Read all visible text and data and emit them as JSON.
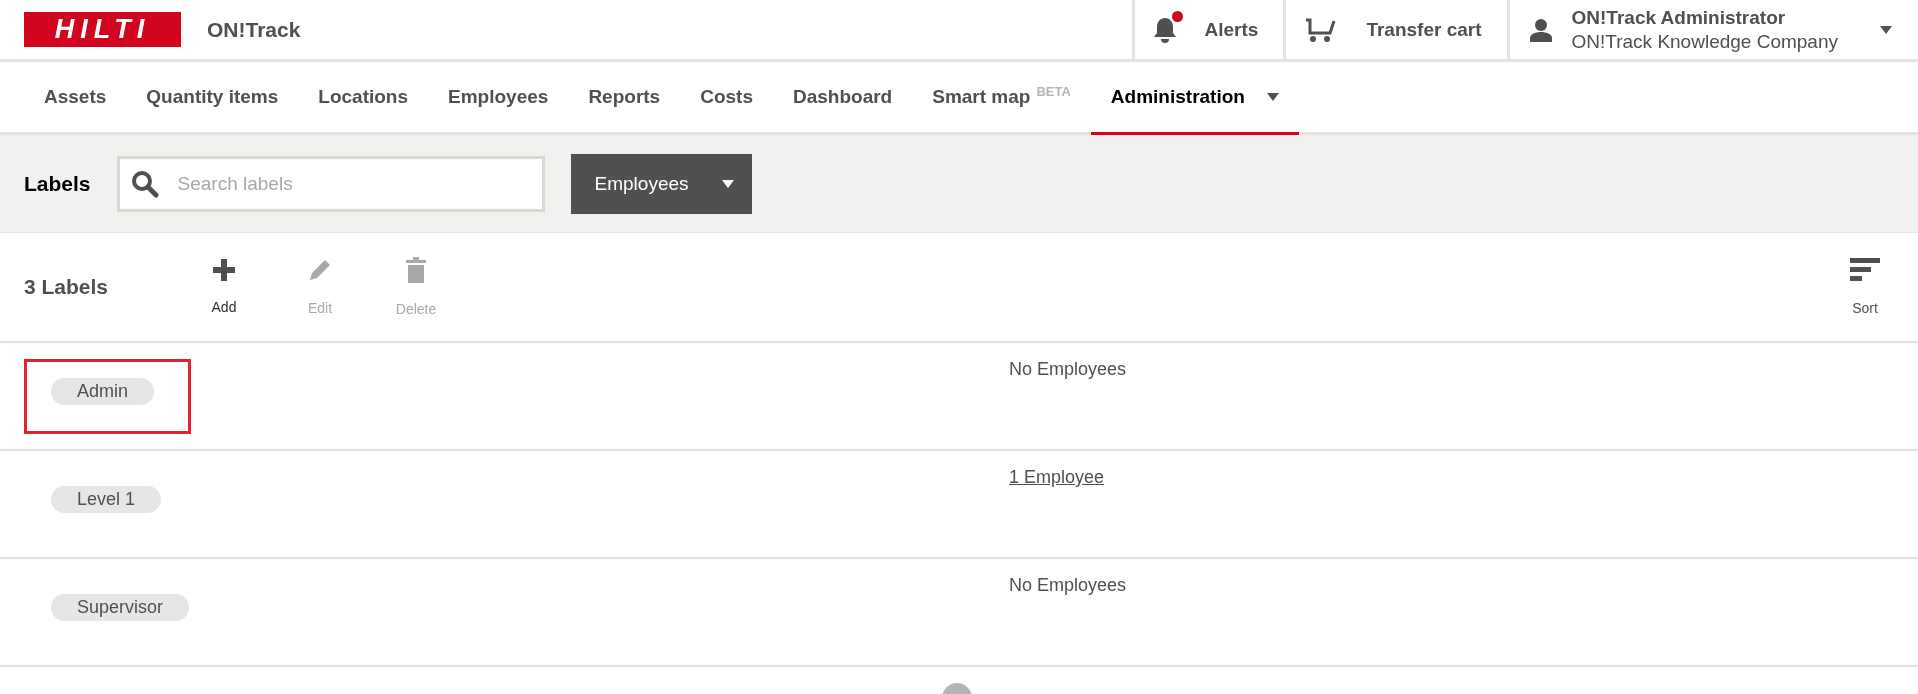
{
  "header": {
    "logo": "HILTI",
    "app_name": "ON!Track",
    "alerts": {
      "label": "Alerts",
      "unread": true
    },
    "transfer_cart": {
      "label": "Transfer cart"
    },
    "user": {
      "name": "ON!Track Administrator",
      "company": "ON!Track Knowledge Company"
    }
  },
  "nav": [
    {
      "label": "Assets",
      "selected": false
    },
    {
      "label": "Quantity items",
      "selected": false
    },
    {
      "label": "Locations",
      "selected": false
    },
    {
      "label": "Employees",
      "selected": false
    },
    {
      "label": "Reports",
      "selected": false
    },
    {
      "label": "Costs",
      "selected": false
    },
    {
      "label": "Dashboard",
      "selected": false
    },
    {
      "label": "Smart map",
      "badge": "BETA",
      "selected": false
    },
    {
      "label": "Administration",
      "dropdown": true,
      "selected": true
    }
  ],
  "filter_bar": {
    "title": "Labels",
    "search": {
      "placeholder": "Search labels"
    },
    "type_dropdown": "Employees"
  },
  "toolbar": {
    "count": "3 Labels",
    "actions": [
      {
        "kind": "add",
        "label": "Add",
        "disabled": false
      },
      {
        "kind": "edit",
        "label": "Edit",
        "disabled": true
      },
      {
        "kind": "delete",
        "label": "Delete",
        "disabled": true
      }
    ],
    "sort": "Sort"
  },
  "rows": [
    {
      "label": "Admin",
      "highlighted": true,
      "employees": "No Employees",
      "kind": "text"
    },
    {
      "label": "Level 1",
      "highlighted": false,
      "employees": "1 Employee",
      "kind": "link"
    },
    {
      "label": "Supervisor",
      "highlighted": false,
      "employees": "No Employees",
      "kind": "text"
    }
  ]
}
